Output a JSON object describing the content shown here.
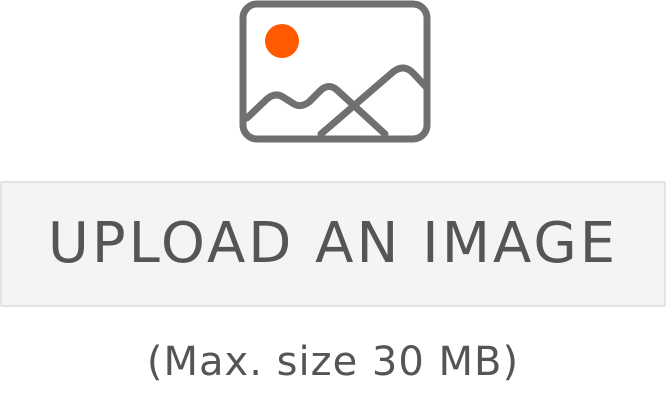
{
  "icon": {
    "name": "image-icon",
    "stroke_color": "#707070",
    "sun_color": "#ff5a00"
  },
  "upload": {
    "button_label": "UPLOAD AN IMAGE"
  },
  "note": {
    "size_limit": "(Max. size 30 MB)"
  }
}
